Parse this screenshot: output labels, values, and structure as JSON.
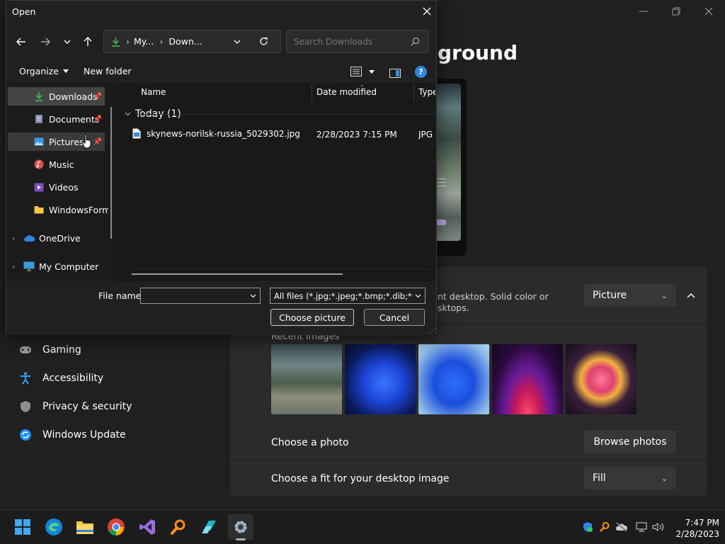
{
  "settings": {
    "heading": "ground",
    "card_description": [
      "nt desktop. Solid color or",
      "sktops."
    ],
    "background_type": "Picture",
    "recent_images_label": "Recent images",
    "choose_photo_label": "Choose a photo",
    "browse_button": "Browse photos",
    "fit_label": "Choose a fit for your desktop image",
    "fit_value": "Fill",
    "nav": [
      {
        "label": "Gaming",
        "icon": "gamepad-icon"
      },
      {
        "label": "Accessibility",
        "icon": "accessibility-icon"
      },
      {
        "label": "Privacy & security",
        "icon": "shield-icon"
      },
      {
        "label": "Windows Update",
        "icon": "update-icon"
      }
    ]
  },
  "dialog": {
    "title": "Open",
    "breadcrumb": [
      "My...",
      "Down..."
    ],
    "search_placeholder": "Search Downloads",
    "toolbar": {
      "organize": "Organize",
      "new_folder": "New folder"
    },
    "tree": [
      {
        "label": "Downloads",
        "icon": "download-icon",
        "pinned": true,
        "selected": true
      },
      {
        "label": "Documents",
        "icon": "document-icon",
        "pinned": true
      },
      {
        "label": "Pictures",
        "icon": "pictures-icon",
        "pinned": true,
        "hover": true
      },
      {
        "label": "Music",
        "icon": "music-icon"
      },
      {
        "label": "Videos",
        "icon": "videos-icon"
      },
      {
        "label": "WindowsForms",
        "icon": "folder-icon"
      },
      {
        "label": "OneDrive",
        "icon": "cloud-icon"
      },
      {
        "label": "My Computer",
        "icon": "computer-icon"
      }
    ],
    "columns": {
      "name": "Name",
      "date": "Date modified",
      "type": "Type"
    },
    "group_label": "Today (1)",
    "files": [
      {
        "name": "skynews-norilsk-russia_5029302.jpg",
        "date": "2/28/2023 7:15 PM",
        "type": "JPG F"
      }
    ],
    "file_name_label": "File name:",
    "file_name_value": "",
    "filter": "All files (*.jpg;*.jpeg;*.bmp;*.dib;*.png",
    "choose_button": "Choose picture",
    "cancel_button": "Cancel"
  },
  "taskbar": {
    "time": "7:47 PM",
    "date": "2/28/2023"
  },
  "colors": {
    "accent_download": "#3fb950",
    "tree_selected": "#3a3a3a"
  }
}
